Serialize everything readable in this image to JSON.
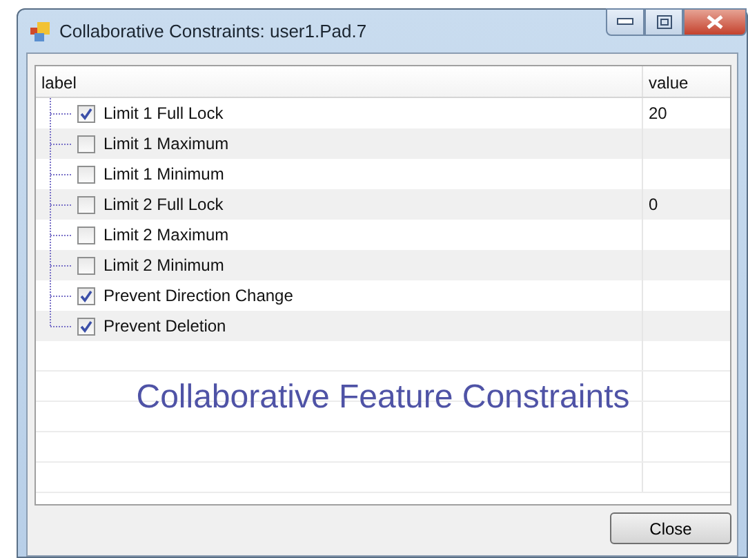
{
  "window": {
    "title": "Collaborative Constraints: user1.Pad.7"
  },
  "table": {
    "columns": [
      "label",
      "value"
    ],
    "rows": [
      {
        "label": "Limit 1 Full Lock",
        "checked": true,
        "value": "20"
      },
      {
        "label": "Limit 1 Maximum",
        "checked": false
      },
      {
        "label": "Limit 1 Minimum",
        "checked": false
      },
      {
        "label": "Limit 2 Full Lock",
        "checked": false,
        "value": "0"
      },
      {
        "label": "Limit 2 Maximum",
        "checked": false
      },
      {
        "label": "Limit 2 Minimum",
        "checked": false
      },
      {
        "label": "Prevent Direction Change",
        "checked": true
      },
      {
        "label": "Prevent Deletion",
        "checked": true
      }
    ]
  },
  "caption": "Collaborative Feature Constraints",
  "buttons": [
    "Close"
  ]
}
